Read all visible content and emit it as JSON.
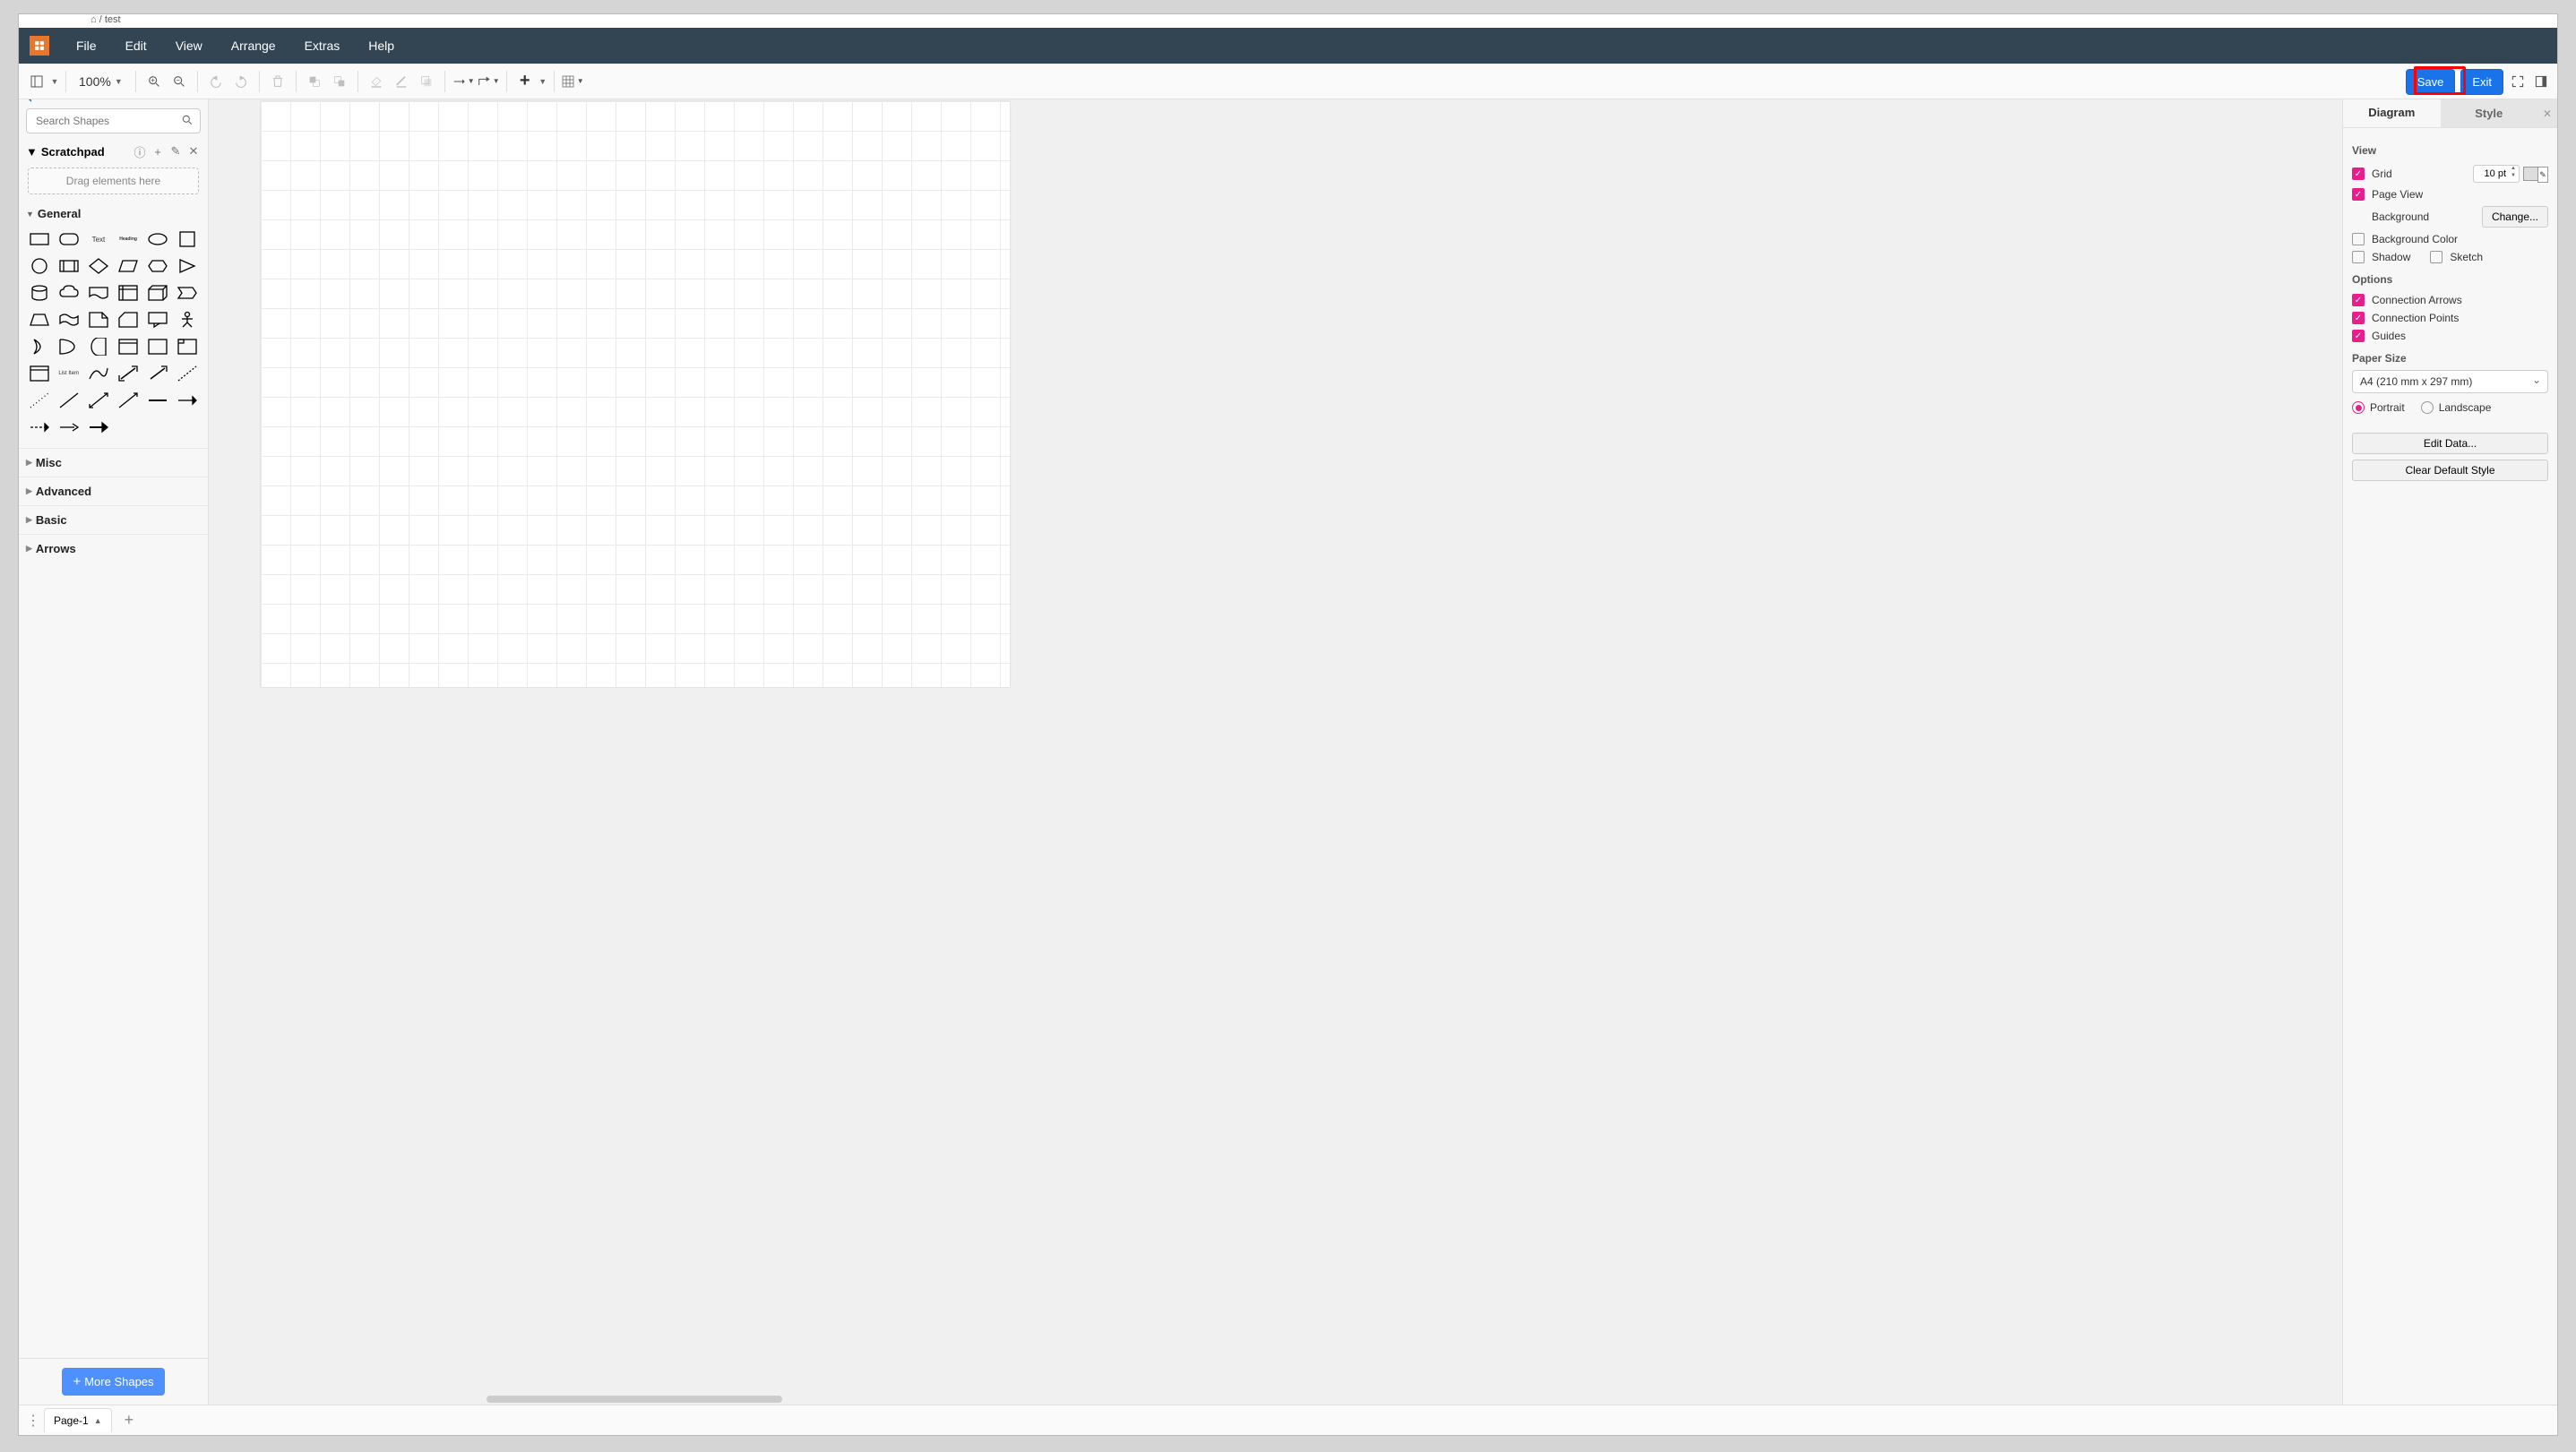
{
  "breadcrumb": "⌂ / test",
  "menu": {
    "file": "File",
    "edit": "Edit",
    "view": "View",
    "arrange": "Arrange",
    "extras": "Extras",
    "help": "Help"
  },
  "toolbar": {
    "zoom": "100%",
    "save": "Save",
    "exit": "Exit"
  },
  "sidebar": {
    "search_placeholder": "Search Shapes",
    "scratchpad_title": "Scratchpad",
    "drop_hint": "Drag elements here",
    "general": "General",
    "text_label": "Text",
    "heading_label": "Heading",
    "listitem_label": "List Item",
    "misc": "Misc",
    "advanced": "Advanced",
    "basic": "Basic",
    "arrows": "Arrows",
    "more_shapes": "More Shapes"
  },
  "right": {
    "tab_diagram": "Diagram",
    "tab_style": "Style",
    "view_title": "View",
    "grid": "Grid",
    "grid_value": "10 pt",
    "page_view": "Page View",
    "background": "Background",
    "change": "Change...",
    "bg_color": "Background Color",
    "shadow": "Shadow",
    "sketch": "Sketch",
    "options_title": "Options",
    "conn_arrows": "Connection Arrows",
    "conn_points": "Connection Points",
    "guides": "Guides",
    "paper_title": "Paper Size",
    "paper_value": "A4 (210 mm x 297 mm)",
    "portrait": "Portrait",
    "landscape": "Landscape",
    "edit_data": "Edit Data...",
    "clear_style": "Clear Default Style"
  },
  "footer": {
    "page1": "Page-1"
  }
}
